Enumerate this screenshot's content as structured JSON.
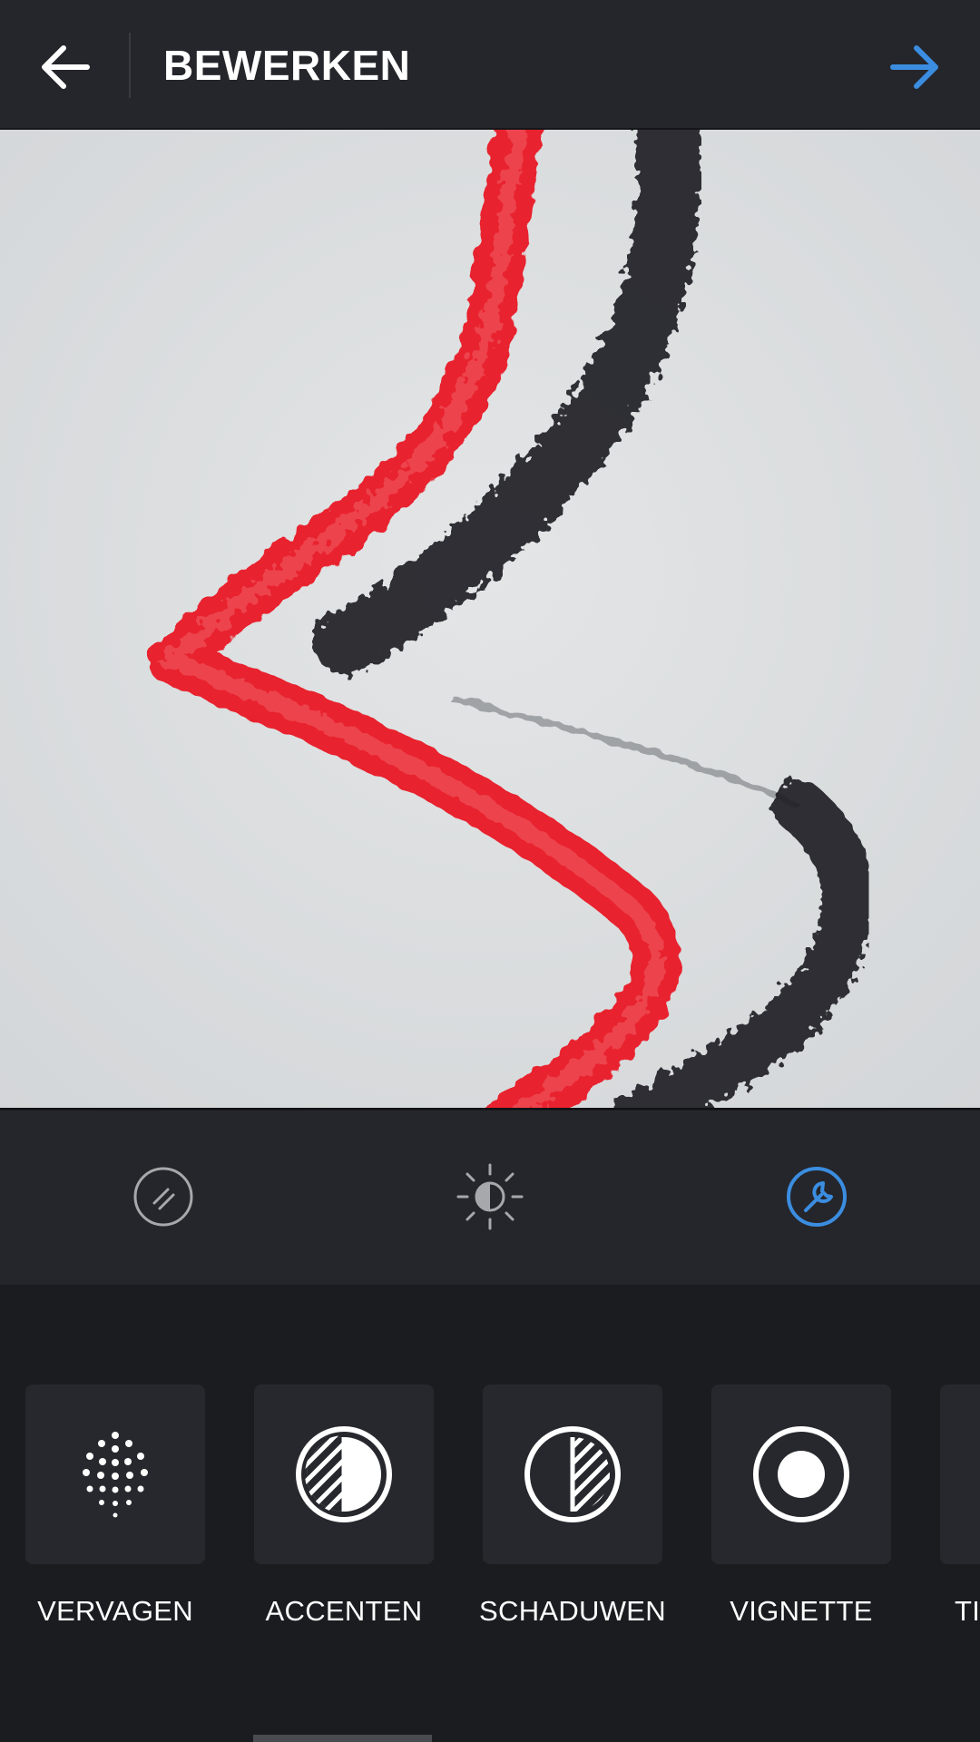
{
  "header": {
    "title": "BEWERKEN",
    "back_icon": "arrow-left-icon",
    "next_icon": "arrow-right-icon",
    "accent_color": "#3b8de0"
  },
  "photo": {
    "description_colors": {
      "paper": "#dfe1e2",
      "red_stroke": "#e8232f",
      "black_stroke": "#1a1c1f"
    }
  },
  "toolbar": {
    "tools": [
      {
        "icon": "filter-icon",
        "active": false
      },
      {
        "icon": "lux-brightness-icon",
        "active": false
      },
      {
        "icon": "wrench-edit-icon",
        "active": true
      }
    ]
  },
  "edit_tools": [
    {
      "label": "VERVAGEN",
      "icon": "dots-fade-icon"
    },
    {
      "label": "ACCENTEN",
      "icon": "highlights-icon"
    },
    {
      "label": "SCHADUWEN",
      "icon": "shadows-icon"
    },
    {
      "label": "VIGNETTE",
      "icon": "vignette-icon"
    },
    {
      "label": "TI",
      "icon": "tilt-shift-icon"
    }
  ]
}
